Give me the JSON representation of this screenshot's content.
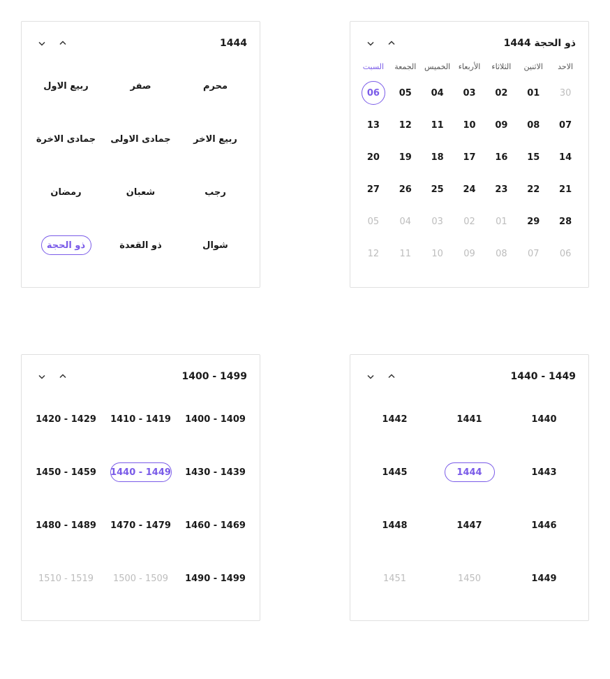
{
  "dayPicker": {
    "title": "ذو الحجة 1444",
    "weekdays": [
      {
        "label": "الاحد",
        "weekend": false
      },
      {
        "label": "الاثنين",
        "weekend": false
      },
      {
        "label": "الثلاثاء",
        "weekend": false
      },
      {
        "label": "الأربعاء",
        "weekend": false
      },
      {
        "label": "الخميس",
        "weekend": false
      },
      {
        "label": "الجمعة",
        "weekend": false
      },
      {
        "label": "السبت",
        "weekend": true
      }
    ],
    "rows": [
      [
        {
          "n": "30",
          "out": true
        },
        {
          "n": "01"
        },
        {
          "n": "02"
        },
        {
          "n": "03"
        },
        {
          "n": "04"
        },
        {
          "n": "05"
        },
        {
          "n": "06",
          "selected": true
        }
      ],
      [
        {
          "n": "07"
        },
        {
          "n": "08"
        },
        {
          "n": "09"
        },
        {
          "n": "10"
        },
        {
          "n": "11"
        },
        {
          "n": "12"
        },
        {
          "n": "13"
        }
      ],
      [
        {
          "n": "14"
        },
        {
          "n": "15"
        },
        {
          "n": "16"
        },
        {
          "n": "17"
        },
        {
          "n": "18"
        },
        {
          "n": "19"
        },
        {
          "n": "20"
        }
      ],
      [
        {
          "n": "21"
        },
        {
          "n": "22"
        },
        {
          "n": "23"
        },
        {
          "n": "24"
        },
        {
          "n": "25"
        },
        {
          "n": "26"
        },
        {
          "n": "27"
        }
      ],
      [
        {
          "n": "28"
        },
        {
          "n": "29"
        },
        {
          "n": "01",
          "out": true
        },
        {
          "n": "02",
          "out": true
        },
        {
          "n": "03",
          "out": true
        },
        {
          "n": "04",
          "out": true
        },
        {
          "n": "05",
          "out": true
        }
      ],
      [
        {
          "n": "06",
          "out": true
        },
        {
          "n": "07",
          "out": true
        },
        {
          "n": "08",
          "out": true
        },
        {
          "n": "09",
          "out": true
        },
        {
          "n": "10",
          "out": true
        },
        {
          "n": "11",
          "out": true
        },
        {
          "n": "12",
          "out": true
        }
      ]
    ]
  },
  "monthPicker": {
    "title": "1444",
    "months": [
      {
        "label": "محرم"
      },
      {
        "label": "صفر"
      },
      {
        "label": "ربيع الاول"
      },
      {
        "label": "ربيع الاخر"
      },
      {
        "label": "جمادى الاولى"
      },
      {
        "label": "جمادى الاخرة"
      },
      {
        "label": "رجب"
      },
      {
        "label": "شعبان"
      },
      {
        "label": "رمضان"
      },
      {
        "label": "شوال"
      },
      {
        "label": "ذو القعدة"
      },
      {
        "label": "ذو الحجة",
        "selected": true
      }
    ]
  },
  "yearPicker": {
    "title": "1440 - 1449",
    "years": [
      {
        "label": "1440"
      },
      {
        "label": "1441"
      },
      {
        "label": "1442"
      },
      {
        "label": "1443"
      },
      {
        "label": "1444",
        "selected": true
      },
      {
        "label": "1445"
      },
      {
        "label": "1446"
      },
      {
        "label": "1447"
      },
      {
        "label": "1448"
      },
      {
        "label": "1449"
      },
      {
        "label": "1450",
        "out": true
      },
      {
        "label": "1451",
        "out": true
      }
    ]
  },
  "decadePicker": {
    "title": "1400 - 1499",
    "decades": [
      {
        "label": "1400 - 1409"
      },
      {
        "label": "1410 - 1419"
      },
      {
        "label": "1420 - 1429"
      },
      {
        "label": "1430 - 1439"
      },
      {
        "label": "1440 - 1449",
        "selected": true
      },
      {
        "label": "1450 - 1459"
      },
      {
        "label": "1460 - 1469"
      },
      {
        "label": "1470 - 1479"
      },
      {
        "label": "1480 - 1489"
      },
      {
        "label": "1490 - 1499"
      },
      {
        "label": "1500 - 1509",
        "out": true
      },
      {
        "label": "1510 - 1519",
        "out": true
      }
    ]
  }
}
